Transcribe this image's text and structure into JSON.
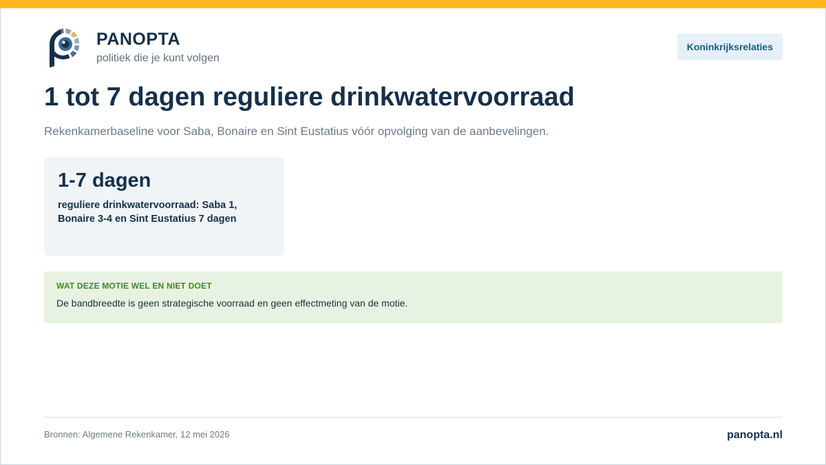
{
  "brand": {
    "name": "PANOPTA",
    "tagline": "politiek die je kunt volgen",
    "footer_site": "panopta.nl"
  },
  "topic_pill": {
    "label": "Koninkrijksrelaties"
  },
  "headline": {
    "title": "1 tot 7 dagen reguliere drinkwatervoorraad",
    "subtitle": "Rekenkamerbaseline voor Saba, Bonaire en Sint Eustatius vóór opvolging van de aanbevelingen."
  },
  "stat_card": {
    "value": "1-7 dagen",
    "description": "reguliere drinkwatervoorraad: Saba 1, Bonaire 3-4 en Sint Eustatius 7 dagen"
  },
  "note": {
    "heading": "WAT DEZE MOTIE WEL EN NIET DOET",
    "body": "De bandbreedte is geen strategische voorraad en geen effectmeting van de motie."
  },
  "footer": {
    "sources": "Bronnen: Algemene Rekenkamer, 12 mei 2026"
  },
  "colors": {
    "accent_bar": "#fdb61f",
    "navy": "#15304a",
    "note_green": "#3f8a1e"
  }
}
